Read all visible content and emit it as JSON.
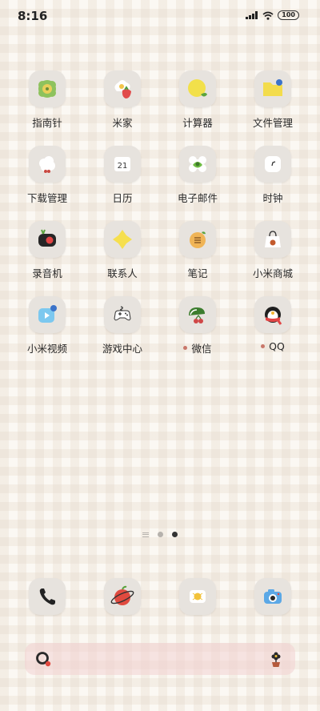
{
  "status_bar": {
    "time": "8:16",
    "battery": "100",
    "icons": [
      "signal-icon",
      "wifi-icon",
      "battery-icon"
    ]
  },
  "apps": [
    {
      "label": "指南针",
      "icon": "compass-icon",
      "notify": false
    },
    {
      "label": "米家",
      "icon": "mijia-icon",
      "notify": false
    },
    {
      "label": "计算器",
      "icon": "calculator-icon",
      "notify": false
    },
    {
      "label": "文件管理",
      "icon": "file-manager-icon",
      "notify": false
    },
    {
      "label": "下载管理",
      "icon": "download-manager-icon",
      "notify": false
    },
    {
      "label": "日历",
      "icon": "calendar-icon",
      "notify": false
    },
    {
      "label": "电子邮件",
      "icon": "email-icon",
      "notify": false
    },
    {
      "label": "时钟",
      "icon": "clock-icon",
      "notify": false
    },
    {
      "label": "录音机",
      "icon": "recorder-icon",
      "notify": false
    },
    {
      "label": "联系人",
      "icon": "contacts-icon",
      "notify": false
    },
    {
      "label": "笔记",
      "icon": "notes-icon",
      "notify": false
    },
    {
      "label": "小米商城",
      "icon": "mi-store-icon",
      "notify": false
    },
    {
      "label": "小米视频",
      "icon": "mi-video-icon",
      "notify": false
    },
    {
      "label": "游戏中心",
      "icon": "game-center-icon",
      "notify": false
    },
    {
      "label": "微信",
      "icon": "wechat-icon",
      "notify": true
    },
    {
      "label": "QQ",
      "icon": "qq-icon",
      "notify": true
    }
  ],
  "calendar_day": "21",
  "page_indicator": {
    "pages": 2,
    "active": 2
  },
  "dock": [
    {
      "icon": "phone-icon"
    },
    {
      "icon": "browser-icon"
    },
    {
      "icon": "messages-icon"
    },
    {
      "icon": "camera-icon"
    }
  ],
  "search_bar": {
    "left_icon": "search-icon",
    "right_icon": "flower-pot-icon"
  },
  "colors": {
    "notify_dot": "#c9776a",
    "icon_bg": "#e7e3de",
    "search_bg": "#f2d2d2"
  }
}
